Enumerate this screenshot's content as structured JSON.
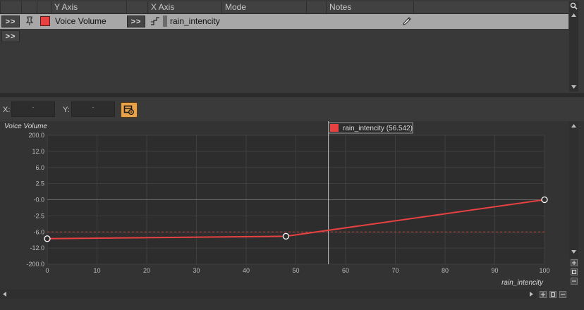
{
  "table": {
    "columns": [
      "Y Axis",
      "X Axis",
      "Mode",
      "Notes"
    ],
    "row": {
      "expand_label": ">>",
      "y_axis": "Voice Volume",
      "x_expand_label": ">>",
      "x_axis": "rain_intencity",
      "y_color": "#e84141"
    },
    "add_row_label": ">>"
  },
  "toolbar": {
    "x_label": "X:",
    "y_label": "Y:",
    "x_value": "-",
    "y_value": "-"
  },
  "graph": {
    "y_title": "Voice Volume",
    "x_title": "rain_intencity",
    "cursor_label": "rain_intencity (56.542)",
    "cursor_color": "#e84141"
  },
  "chart_data": {
    "type": "line",
    "x_ticks": [
      0,
      10,
      20,
      30,
      40,
      50,
      60,
      70,
      80,
      90,
      100
    ],
    "y_tick_labels": [
      "200.0",
      "12.0",
      "6.0",
      "2.5",
      "-0.0",
      "-2.5",
      "-6.0",
      "-12.0",
      "-200.0"
    ],
    "xlim": [
      0,
      100
    ],
    "points": [
      {
        "x": 0,
        "y": "-8.5"
      },
      {
        "x": 48,
        "y": "-7.6"
      },
      {
        "x": 100,
        "y": "0.0"
      }
    ],
    "cursor_x": 56.542,
    "cursor_y": "-6.0",
    "line_color": "#e84141",
    "grid": true
  }
}
